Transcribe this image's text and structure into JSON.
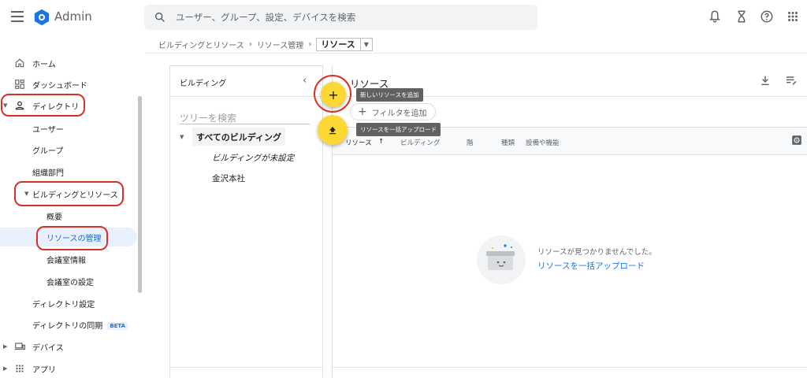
{
  "header": {
    "app_name": "Admin",
    "search_placeholder": "ユーザー、グループ、設定、デバイスを検索"
  },
  "breadcrumb": {
    "items": [
      "ビルディングとリソース",
      "リソース管理"
    ],
    "current": "リソース"
  },
  "sidebar": {
    "home": "ホーム",
    "dashboard": "ダッシュボード",
    "directory": "ディレクトリ",
    "users": "ユーザー",
    "groups": "グループ",
    "org_units": "組織部門",
    "buildings_resources": "ビルディングとリソース",
    "overview": "概要",
    "manage_resources": "リソースの管理",
    "room_info": "会議室情報",
    "room_settings": "会議室の設定",
    "directory_settings": "ディレクトリ設定",
    "directory_sync": "ディレクトリの同期",
    "beta": "BETA",
    "devices": "デバイス",
    "apps": "アプリ"
  },
  "tree": {
    "title": "ビルディング",
    "search_placeholder": "ツリーを検索",
    "all_buildings": "すべてのビルディング",
    "unassigned": "ビルディングが未設定",
    "building_1": "金沢本社"
  },
  "resources": {
    "title": "リソース",
    "add_filter": "フィルタを追加",
    "columns": [
      "リソース",
      "ビルディング",
      "階",
      "種類",
      "設備や機能"
    ],
    "empty_message": "リソースが見つかりませんでした。",
    "bulk_upload_link": "リソースを一括アップロード",
    "tooltip_add": "新しいリソースを追加",
    "tooltip_bulk": "リソースを一括アップロード"
  },
  "colors": {
    "accent": "#1a73e8",
    "fab": "#fdd835",
    "highlight": "#d93025",
    "active_bg": "#e8f0fe"
  }
}
